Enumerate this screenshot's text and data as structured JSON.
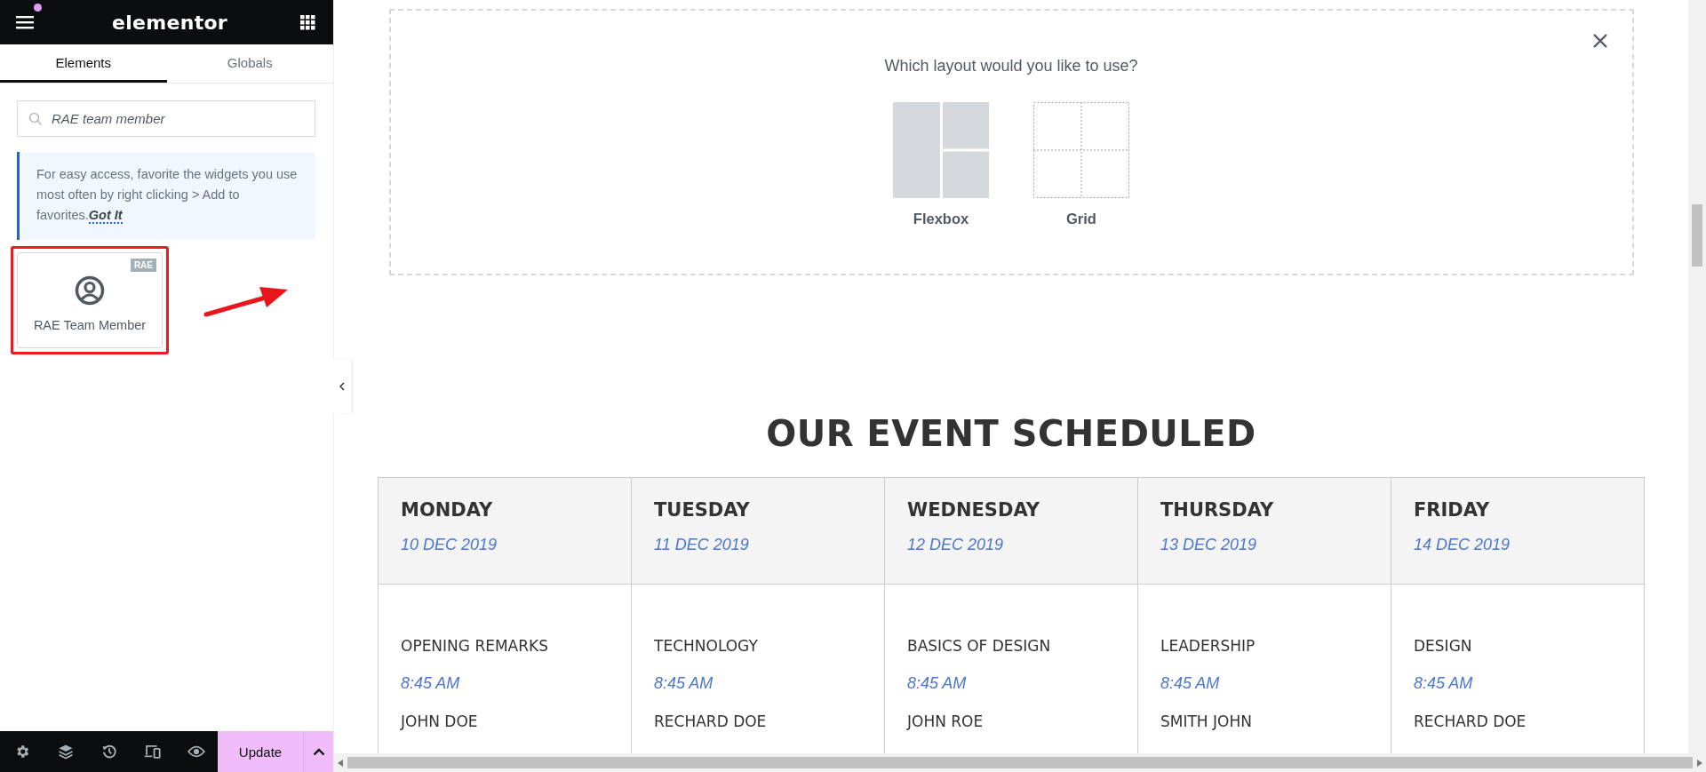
{
  "panel": {
    "logo": "elementor",
    "tabs": [
      {
        "label": "Elements",
        "selected": true
      },
      {
        "label": "Globals",
        "selected": false
      }
    ],
    "search": {
      "value": "RAE team member"
    },
    "tip": {
      "text": "For easy access, favorite the widgets you use most often by right clicking > Add to favorites.",
      "link": "Got It"
    },
    "widgets": [
      {
        "label": "RAE Team Member",
        "badge": "RAE",
        "highlighted": true
      }
    ],
    "footer": {
      "update_button": "Update"
    }
  },
  "layout_picker": {
    "question": "Which layout would you like to use?",
    "options": [
      {
        "label": "Flexbox",
        "kind": "flexbox"
      },
      {
        "label": "Grid",
        "kind": "grid"
      }
    ]
  },
  "schedule": {
    "title": "OUR EVENT SCHEDULED",
    "days": [
      {
        "day": "MONDAY",
        "date": "10 DEC 2019",
        "session": "OPENING REMARKS",
        "time": "8:45 AM",
        "speaker": "JOHN DOE"
      },
      {
        "day": "TUESDAY",
        "date": "11 DEC 2019",
        "session": "TECHNOLOGY",
        "time": "8:45 AM",
        "speaker": "RECHARD DOE"
      },
      {
        "day": "WEDNESDAY",
        "date": "12 DEC 2019",
        "session": "BASICS OF DESIGN",
        "time": "8:45 AM",
        "speaker": "JOHN ROE"
      },
      {
        "day": "THURSDAY",
        "date": "13 DEC 2019",
        "session": "LEADERSHIP",
        "time": "8:45 AM",
        "speaker": "SMITH JOHN"
      },
      {
        "day": "FRIDAY",
        "date": "14 DEC 2019",
        "session": "DESIGN",
        "time": "8:45 AM",
        "speaker": "RECHARD DOE"
      }
    ]
  }
}
